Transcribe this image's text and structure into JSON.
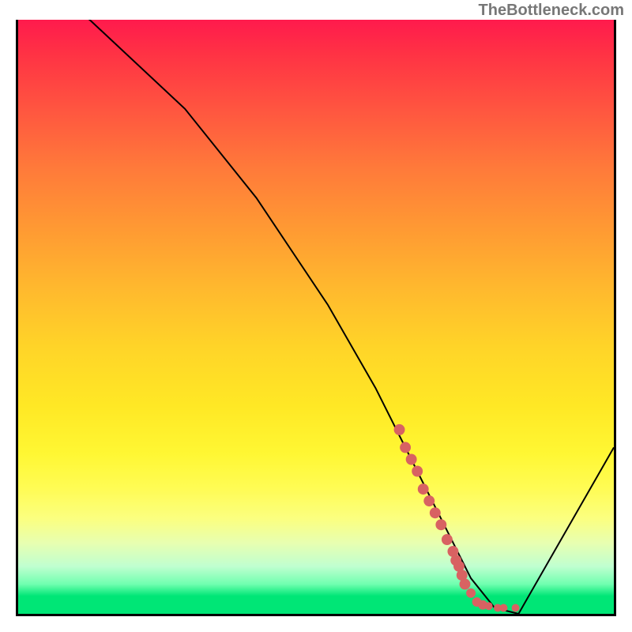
{
  "watermark": "TheBottleneck.com",
  "chart_data": {
    "type": "line",
    "title": "",
    "xlabel": "",
    "ylabel": "",
    "xlim": [
      0,
      100
    ],
    "ylim": [
      0,
      100
    ],
    "series": [
      {
        "name": "bottleneck-curve",
        "x": [
          0,
          12,
          28,
          40,
          52,
          60,
          66,
          72,
          76,
          80,
          84,
          100
        ],
        "y": [
          108,
          100,
          85,
          70,
          52,
          38,
          26,
          14,
          6,
          1,
          0,
          28
        ]
      }
    ],
    "scatter": {
      "name": "highlighted-points",
      "color": "#d86262",
      "points": [
        {
          "x": 64,
          "y": 31
        },
        {
          "x": 65,
          "y": 28
        },
        {
          "x": 66,
          "y": 26
        },
        {
          "x": 67,
          "y": 24
        },
        {
          "x": 68,
          "y": 21
        },
        {
          "x": 69,
          "y": 19
        },
        {
          "x": 70,
          "y": 17
        },
        {
          "x": 71,
          "y": 15
        },
        {
          "x": 72,
          "y": 12.5
        },
        {
          "x": 73,
          "y": 10.5
        },
        {
          "x": 73.5,
          "y": 9
        },
        {
          "x": 74,
          "y": 8
        },
        {
          "x": 74.5,
          "y": 6.5
        },
        {
          "x": 75,
          "y": 5
        },
        {
          "x": 76,
          "y": 3.5
        },
        {
          "x": 77,
          "y": 2
        },
        {
          "x": 78,
          "y": 1.5
        },
        {
          "x": 79,
          "y": 1.3
        },
        {
          "x": 80.5,
          "y": 1.0
        },
        {
          "x": 81.5,
          "y": 1.0
        },
        {
          "x": 83.5,
          "y": 1.0
        }
      ]
    },
    "background_gradient": {
      "top": "#ff1a4d",
      "mid": "#ffe825",
      "bottom": "#00e676"
    }
  }
}
